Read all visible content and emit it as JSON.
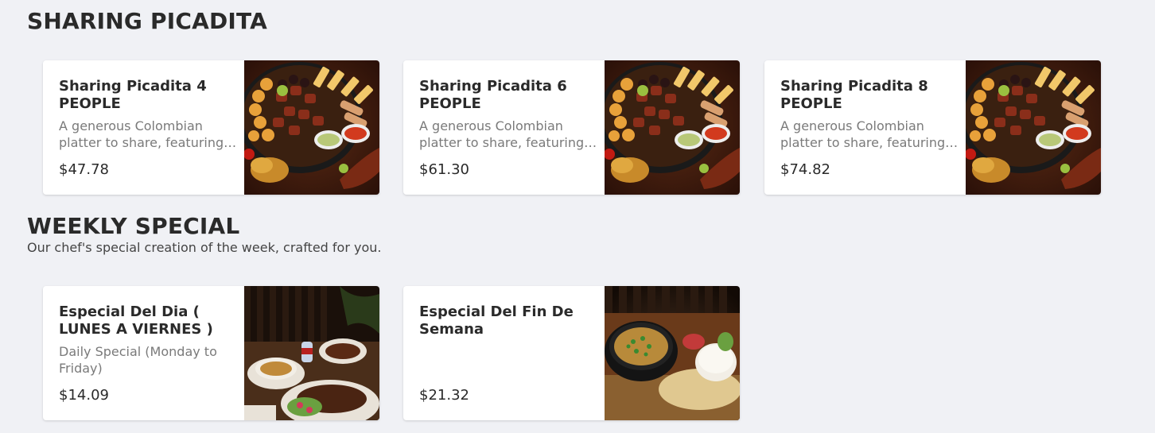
{
  "sections": [
    {
      "title": "SHARING PICADITA",
      "items": [
        {
          "name": "Sharing Picadita 4 PEOPLE",
          "description": "A generous Colombian platter to share, featuring…",
          "price": "$47.78",
          "image": "picadita-platter"
        },
        {
          "name": "Sharing Picadita 6 PEOPLE",
          "description": "A generous Colombian platter to share, featuring…",
          "price": "$61.30",
          "image": "picadita-platter"
        },
        {
          "name": "Sharing Picadita 8 PEOPLE",
          "description": "A generous Colombian platter to share, featuring…",
          "price": "$74.82",
          "image": "picadita-platter"
        }
      ]
    },
    {
      "title": "WEEKLY SPECIAL",
      "subtitle": "Our chef's special creation of the week, crafted for you.",
      "items": [
        {
          "name": "Especial Del Dia ( LUNES A VIERNES )",
          "description": "Daily Special (Monday to Friday)",
          "price": "$14.09",
          "image": "daily-special-meal"
        },
        {
          "name": "Especial Del Fin De Semana",
          "description": "",
          "price": "$21.32",
          "image": "weekend-soup-meal"
        }
      ]
    }
  ]
}
